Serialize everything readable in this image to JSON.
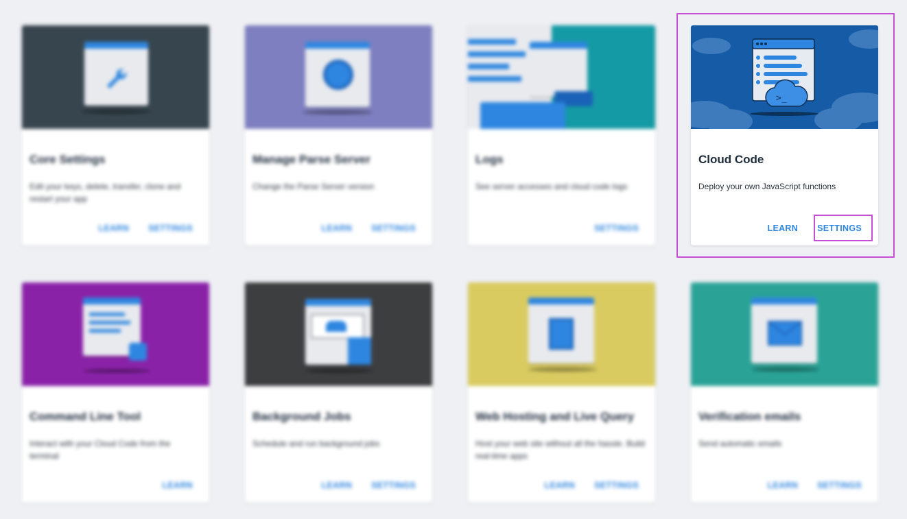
{
  "colors": {
    "page_background": "#eef0f4",
    "action_link": "#2e86e0",
    "highlight": "#c64fd6"
  },
  "cards": [
    {
      "title": "Core Settings",
      "description": "Edit your keys, delete, transfer, clone and restart your app",
      "actions": [
        "LEARN",
        "SETTINGS"
      ],
      "banner_color": "#37454e",
      "icon": "wrench-icon",
      "blurred": true
    },
    {
      "title": "Manage Parse Server",
      "description": "Change the Parse Server version",
      "actions": [
        "LEARN",
        "SETTINGS"
      ],
      "banner_color": "#7e7fc0",
      "icon": "gear-icon",
      "blurred": true
    },
    {
      "title": "Logs",
      "description": "See server accesses and cloud code logs",
      "actions": [
        "SETTINGS"
      ],
      "banner_color": "#149aa4",
      "icon": "logs-window-icon",
      "blurred": true
    },
    {
      "title": "Cloud Code",
      "description": "Deploy your own JavaScript functions",
      "actions": [
        "LEARN",
        "SETTINGS"
      ],
      "banner_color": "#155ba6",
      "icon": "cloud-terminal-icon",
      "blurred": false
    },
    {
      "title": "Command Line Tool",
      "description": "Interact with your Cloud Code from the terminal",
      "actions": [
        "LEARN"
      ],
      "banner_color": "#8a22a8",
      "icon": "terminal-window-icon",
      "blurred": true
    },
    {
      "title": "Background Jobs",
      "description": "Schedule and run background jobs",
      "actions": [
        "LEARN",
        "SETTINGS"
      ],
      "banner_color": "#3d3e40",
      "icon": "jobs-window-icon",
      "blurred": true
    },
    {
      "title": "Web Hosting and Live Query",
      "description": "Host your web site without all the hassle. Build real-time apps",
      "actions": [
        "LEARN",
        "SETTINGS"
      ],
      "banner_color": "#d9cb60",
      "icon": "server-window-icon",
      "blurred": true
    },
    {
      "title": "Verification emails",
      "description": "Send automatic emails",
      "actions": [
        "LEARN",
        "SETTINGS"
      ],
      "banner_color": "#2aa396",
      "icon": "envelope-icon",
      "blurred": true
    }
  ]
}
